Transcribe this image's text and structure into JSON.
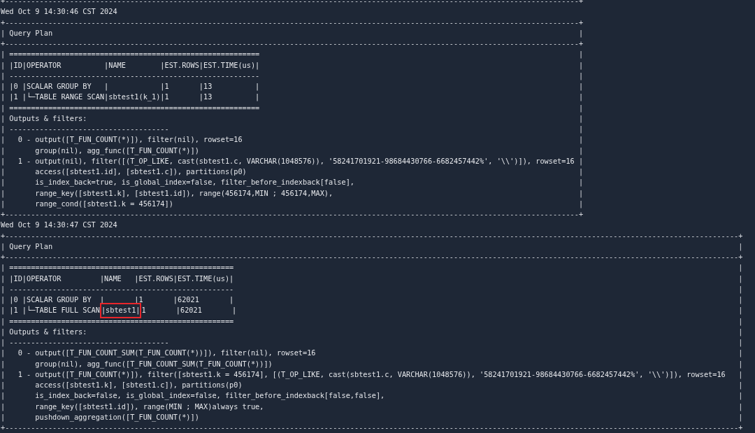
{
  "lines": [
    {
      "kind": "rule",
      "text": "+-------------------------------------------------------------------------------------------------------------------------------------+"
    },
    {
      "kind": "plain",
      "text": "Wed Oct 9 14:30:46 CST 2024"
    },
    {
      "kind": "rule",
      "text": "+-------------------------------------------------------------------------------------------------------------------------------------+"
    },
    {
      "kind": "boxed",
      "left": "|",
      "right": "|",
      "segments": [
        {
          "text": " Query Plan",
          "highlighted": false
        }
      ]
    },
    {
      "kind": "rule",
      "text": "+-------------------------------------------------------------------------------------------------------------------------------------+"
    },
    {
      "kind": "boxed",
      "left": "|",
      "right": "|",
      "segments": [
        {
          "text": " ==========================================================",
          "highlighted": false
        }
      ]
    },
    {
      "kind": "boxed",
      "left": "|",
      "right": "|",
      "segments": [
        {
          "text": " |ID|OPERATOR          |NAME        |EST.ROWS|EST.TIME(us)|",
          "highlighted": false
        }
      ]
    },
    {
      "kind": "boxed",
      "left": "|",
      "right": "|",
      "segments": [
        {
          "text": " ----------------------------------------------------------",
          "highlighted": false
        }
      ]
    },
    {
      "kind": "boxed",
      "left": "|",
      "right": "|",
      "segments": [
        {
          "text": " |0 |SCALAR GROUP BY   |            |1       |13          |",
          "highlighted": false
        }
      ]
    },
    {
      "kind": "boxed",
      "left": "|",
      "right": "|",
      "segments": [
        {
          "text": " |1 |└─TABLE RANGE SCAN|sbtest1(k_1)|1       |13          |",
          "highlighted": false
        }
      ]
    },
    {
      "kind": "boxed",
      "left": "|",
      "right": "|",
      "segments": [
        {
          "text": " ==========================================================",
          "highlighted": false
        }
      ]
    },
    {
      "kind": "boxed",
      "left": "|",
      "right": "|",
      "segments": [
        {
          "text": " Outputs & filters:",
          "highlighted": false
        }
      ]
    },
    {
      "kind": "boxed",
      "left": "|",
      "right": "|",
      "segments": [
        {
          "text": " -------------------------------------",
          "highlighted": false
        }
      ]
    },
    {
      "kind": "boxed",
      "left": "|",
      "right": "|",
      "segments": [
        {
          "text": "   0 - output([T_FUN_COUNT(*)]), filter(nil), rowset=16",
          "highlighted": false
        }
      ]
    },
    {
      "kind": "boxed",
      "left": "|",
      "right": "|",
      "segments": [
        {
          "text": "       group(nil), agg_func([T_FUN_COUNT(*)])",
          "highlighted": false
        }
      ]
    },
    {
      "kind": "boxed",
      "left": "|",
      "right": "|",
      "segments": [
        {
          "text": "   1 - output(nil), filter([(T_OP_LIKE, cast(sbtest1.c, VARCHAR(1048576)), '58241701921-98684430766-6682457442%', '\\\\')]), rowset=16",
          "highlighted": false
        }
      ]
    },
    {
      "kind": "boxed",
      "left": "|",
      "right": "|",
      "segments": [
        {
          "text": "       access([sbtest1.id], [sbtest1.c]), partitions(p0)",
          "highlighted": false
        }
      ]
    },
    {
      "kind": "boxed",
      "left": "|",
      "right": "|",
      "segments": [
        {
          "text": "       is_index_back=true, is_global_index=false, filter_before_indexback[false],",
          "highlighted": false
        }
      ]
    },
    {
      "kind": "boxed",
      "left": "|",
      "right": "|",
      "segments": [
        {
          "text": "       range_key([sbtest1.k], [sbtest1.id]), range(456174,MIN ; 456174,MAX),",
          "highlighted": false
        }
      ]
    },
    {
      "kind": "boxed",
      "left": "|",
      "right": "|",
      "segments": [
        {
          "text": "       range_cond([sbtest1.k = 456174])",
          "highlighted": false
        }
      ]
    },
    {
      "kind": "rule",
      "text": "+-------------------------------------------------------------------------------------------------------------------------------------+"
    },
    {
      "kind": "plain",
      "text": "Wed Oct 9 14:30:47 CST 2024"
    },
    {
      "kind": "rule",
      "text": "+--------------------------------------------------------------------------------------------------------------------------------------------------------------------------+"
    },
    {
      "kind": "boxed",
      "left": "|",
      "right": "|",
      "segments": [
        {
          "text": " Query Plan",
          "highlighted": false
        }
      ]
    },
    {
      "kind": "rule",
      "text": "+--------------------------------------------------------------------------------------------------------------------------------------------------------------------------+"
    },
    {
      "kind": "boxed",
      "left": "|",
      "right": "|",
      "segments": [
        {
          "text": " ====================================================",
          "highlighted": false
        }
      ]
    },
    {
      "kind": "boxed",
      "left": "|",
      "right": "|",
      "segments": [
        {
          "text": " |ID|OPERATOR         |NAME   |EST.ROWS|EST.TIME(us)|",
          "highlighted": false
        }
      ]
    },
    {
      "kind": "boxed",
      "left": "|",
      "right": "|",
      "segments": [
        {
          "text": " ----------------------------------------------------",
          "highlighted": false
        }
      ]
    },
    {
      "kind": "boxed",
      "left": "|",
      "right": "|",
      "segments": [
        {
          "text": " |0 |SCALAR GROUP BY  |       |1       |62021       |",
          "highlighted": false
        }
      ]
    },
    {
      "kind": "boxed",
      "left": "|",
      "right": "|",
      "segments": [
        {
          "text": " |1 |└─TABLE FULL SCAN",
          "highlighted": false
        },
        {
          "text": "|sbtest1|",
          "highlighted": true
        },
        {
          "text": "1       |62021       |",
          "highlighted": false
        }
      ]
    },
    {
      "kind": "boxed",
      "left": "|",
      "right": "|",
      "segments": [
        {
          "text": " ====================================================",
          "highlighted": false
        }
      ]
    },
    {
      "kind": "boxed",
      "left": "|",
      "right": "|",
      "segments": [
        {
          "text": " Outputs & filters:",
          "highlighted": false
        }
      ]
    },
    {
      "kind": "boxed",
      "left": "|",
      "right": "|",
      "segments": [
        {
          "text": " -------------------------------------",
          "highlighted": false
        }
      ]
    },
    {
      "kind": "boxed",
      "left": "|",
      "right": "|",
      "segments": [
        {
          "text": "   0 - output([T_FUN_COUNT_SUM(T_FUN_COUNT(*))]), filter(nil), rowset=16",
          "highlighted": false
        }
      ]
    },
    {
      "kind": "boxed",
      "left": "|",
      "right": "|",
      "segments": [
        {
          "text": "       group(nil), agg_func([T_FUN_COUNT_SUM(T_FUN_COUNT(*))])",
          "highlighted": false
        }
      ]
    },
    {
      "kind": "boxed",
      "left": "|",
      "right": "|",
      "segments": [
        {
          "text": "   1 - output([T_FUN_COUNT(*)]), filter([sbtest1.k = 456174], [(T_OP_LIKE, cast(sbtest1.c, VARCHAR(1048576)), '58241701921-98684430766-6682457442%', '\\\\')]), rowset=16",
          "highlighted": false
        }
      ]
    },
    {
      "kind": "boxed",
      "left": "|",
      "right": "|",
      "segments": [
        {
          "text": "       access([sbtest1.k], [sbtest1.c]), partitions(p0)",
          "highlighted": false
        }
      ]
    },
    {
      "kind": "boxed",
      "left": "|",
      "right": "|",
      "segments": [
        {
          "text": "       is_index_back=false, is_global_index=false, filter_before_indexback[false,false],",
          "highlighted": false
        }
      ]
    },
    {
      "kind": "boxed",
      "left": "|",
      "right": "|",
      "segments": [
        {
          "text": "       range_key([sbtest1.id]), range(MIN ; MAX)always true,",
          "highlighted": false
        }
      ]
    },
    {
      "kind": "boxed",
      "left": "|",
      "right": "|",
      "segments": [
        {
          "text": "       pushdown_aggregation([T_FUN_COUNT(*)])",
          "highlighted": false
        }
      ]
    },
    {
      "kind": "rule",
      "text": "+--------------------------------------------------------------------------------------------------------------------------------------------------------------------------+"
    }
  ]
}
